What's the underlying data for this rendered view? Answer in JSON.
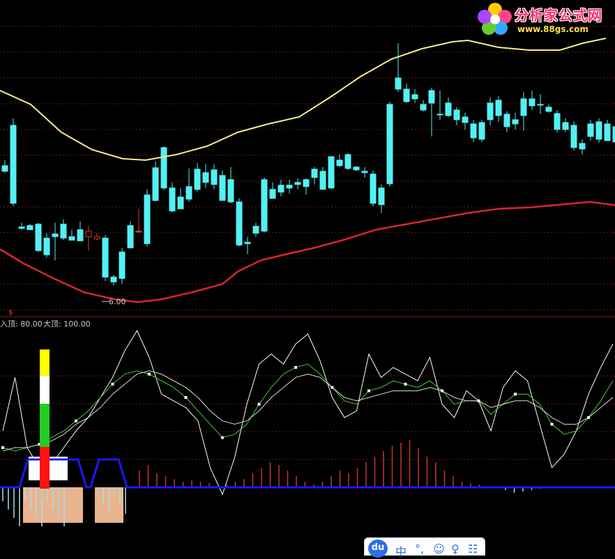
{
  "logo": {
    "site_name": "分析家公式网",
    "url": "www.88gs.com"
  },
  "upper_panel": {
    "low_marker": "6.00",
    "marker_symbol": "$"
  },
  "lower_panel": {
    "info_text_1": "入顶: 80.00",
    "info_text_2": "大顶: 100.00"
  },
  "ime_toolbar": {
    "badge": "du",
    "items": [
      "中",
      "°,",
      "☺",
      "♀",
      "☷"
    ]
  },
  "colors": {
    "background": "#000000",
    "up_candle": "#d9403a",
    "down_candle": "#54f0f2",
    "upper_band": "#f2f08a",
    "lower_band": "#d8272c",
    "osc_white": "#ffffff",
    "osc_green": "#44cc33",
    "baseline": "#1a1aff",
    "block_fill": "#e8b48e"
  },
  "chart_data": [
    {
      "type": "candlestick",
      "series_desc": "price panel",
      "x": [
        1,
        2,
        3,
        4,
        5,
        6,
        7,
        8,
        9,
        10,
        11,
        12,
        13,
        14,
        15,
        16,
        17,
        18,
        19,
        20,
        21,
        22,
        23,
        24,
        25,
        26,
        27,
        28,
        29,
        30,
        31,
        32,
        33,
        34,
        35,
        36,
        37,
        38,
        39,
        40,
        41,
        42,
        43,
        44,
        45,
        46,
        47,
        48,
        49,
        50,
        51,
        52,
        53,
        54,
        55,
        56,
        57,
        58,
        59,
        60,
        61,
        62,
        63,
        64,
        65,
        66,
        67,
        68,
        69,
        70,
        71,
        72,
        73
      ],
      "ohlc": [
        [
          238,
          230,
          248,
          246
        ],
        [
          180,
          170,
          296,
          292
        ],
        [
          326,
          320,
          330,
          328
        ],
        [
          324,
          322,
          330,
          330
        ],
        [
          322,
          320,
          362,
          360
        ],
        [
          342,
          335,
          370,
          366
        ],
        [
          336,
          320,
          374,
          340
        ],
        [
          322,
          315,
          345,
          342
        ],
        [
          340,
          330,
          345,
          345
        ],
        [
          330,
          318,
          346,
          346
        ],
        [
          340,
          325,
          360,
          332
        ],
        [
          343,
          335,
          345,
          340
        ],
        [
          342,
          338,
          404,
          398
        ],
        [
          398,
          395,
          410,
          405
        ],
        [
          362,
          356,
          408,
          400
        ],
        [
          324,
          318,
          357,
          356
        ],
        [
          333,
          300,
          335,
          332
        ],
        [
          280,
          272,
          354,
          350
        ],
        [
          241,
          232,
          289,
          288
        ],
        [
          212,
          210,
          273,
          270
        ],
        [
          270,
          262,
          305,
          303
        ],
        [
          283,
          270,
          300,
          300
        ],
        [
          268,
          242,
          290,
          286
        ],
        [
          243,
          234,
          275,
          272
        ],
        [
          248,
          236,
          270,
          262
        ],
        [
          244,
          236,
          272,
          265
        ],
        [
          252,
          245,
          288,
          288
        ],
        [
          258,
          240,
          292,
          290
        ],
        [
          290,
          285,
          354,
          352
        ],
        [
          348,
          340,
          365,
          350
        ],
        [
          325,
          320,
          340,
          335
        ],
        [
          258,
          255,
          334,
          332
        ],
        [
          272,
          262,
          285,
          285
        ],
        [
          266,
          258,
          282,
          276
        ],
        [
          266,
          258,
          278,
          270
        ],
        [
          262,
          256,
          272,
          265
        ],
        [
          258,
          256,
          280,
          268
        ],
        [
          243,
          240,
          265,
          255
        ],
        [
          246,
          240,
          272,
          272
        ],
        [
          225,
          225,
          272,
          270
        ],
        [
          230,
          222,
          240,
          238
        ],
        [
          222,
          220,
          244,
          242
        ],
        [
          240,
          238,
          246,
          244
        ],
        [
          246,
          240,
          255,
          248
        ],
        [
          250,
          245,
          296,
          292
        ],
        [
          270,
          265,
          306,
          294
        ],
        [
          150,
          146,
          268,
          264
        ],
        [
          112,
          62,
          132,
          128
        ],
        [
          128,
          120,
          148,
          146
        ],
        [
          136,
          128,
          148,
          142
        ],
        [
          150,
          144,
          160,
          158
        ],
        [
          130,
          126,
          196,
          148
        ],
        [
          164,
          130,
          172,
          164
        ],
        [
          148,
          140,
          168,
          166
        ],
        [
          158,
          154,
          180,
          172
        ],
        [
          168,
          162,
          186,
          176
        ],
        [
          178,
          172,
          204,
          198
        ],
        [
          176,
          172,
          204,
          200
        ],
        [
          148,
          140,
          180,
          172
        ],
        [
          144,
          138,
          175,
          166
        ],
        [
          164,
          160,
          190,
          182
        ],
        [
          172,
          162,
          186,
          178
        ],
        [
          142,
          132,
          188,
          166
        ],
        [
          142,
          130,
          158,
          152
        ],
        [
          150,
          135,
          164,
          150
        ],
        [
          154,
          150,
          162,
          160
        ],
        [
          163,
          158,
          190,
          186
        ],
        [
          176,
          170,
          190,
          186
        ],
        [
          180,
          174,
          216,
          212
        ],
        [
          206,
          200,
          222,
          214
        ],
        [
          178,
          172,
          202,
          196
        ],
        [
          175,
          170,
          205,
          200
        ],
        [
          178,
          172,
          202,
          202
        ],
        [
          182,
          176,
          206,
          204
        ],
        [
          186,
          180,
          212,
          206
        ],
        [
          176,
          168,
          204,
          200
        ],
        [
          172,
          165,
          200,
          198
        ],
        [
          166,
          160,
          178,
          170
        ],
        [
          150,
          145,
          172,
          166
        ],
        [
          64,
          52,
          122,
          118
        ]
      ],
      "upper_band": [
        [
          1,
          130
        ],
        [
          5,
          150
        ],
        [
          9,
          190
        ],
        [
          13,
          215
        ],
        [
          17,
          228
        ],
        [
          20,
          230
        ],
        [
          24,
          222
        ],
        [
          28,
          210
        ],
        [
          32,
          190
        ],
        [
          36,
          178
        ],
        [
          40,
          168
        ],
        [
          44,
          140
        ],
        [
          48,
          110
        ],
        [
          52,
          85
        ],
        [
          56,
          70
        ],
        [
          60,
          60
        ],
        [
          62,
          58
        ],
        [
          66,
          68
        ],
        [
          70,
          72
        ],
        [
          74,
          72
        ],
        [
          77,
          62
        ],
        [
          80,
          55
        ]
      ],
      "lower_band": [
        [
          1,
          358
        ],
        [
          4,
          378
        ],
        [
          8,
          400
        ],
        [
          12,
          420
        ],
        [
          16,
          430
        ],
        [
          19,
          434
        ],
        [
          22,
          430
        ],
        [
          26,
          420
        ],
        [
          30,
          408
        ],
        [
          32,
          390
        ],
        [
          35,
          374
        ],
        [
          38,
          366
        ],
        [
          42,
          356
        ],
        [
          46,
          344
        ],
        [
          50,
          330
        ],
        [
          54,
          322
        ],
        [
          58,
          314
        ],
        [
          62,
          306
        ],
        [
          66,
          300
        ],
        [
          70,
          298
        ],
        [
          74,
          294
        ],
        [
          78,
          290
        ],
        [
          82,
          296
        ]
      ]
    },
    {
      "type": "line",
      "series_desc": "oscillator panel",
      "ylim": [
        0,
        100
      ],
      "series": [
        {
          "values": [
            40,
            72,
            30,
            18,
            20,
            30,
            40,
            48,
            60,
            72,
            88,
            100,
            84,
            62,
            58,
            54,
            46,
            18,
            2,
            24,
            56,
            80,
            86,
            80,
            92,
            98,
            82,
            60,
            48,
            52,
            86,
            72,
            78,
            74,
            70,
            84,
            56,
            48,
            64,
            58,
            40,
            66,
            76,
            70,
            44,
            18,
            26,
            40,
            62,
            78,
            92
          ]
        },
        {
          "values": [
            30,
            28,
            30,
            32,
            36,
            40,
            46,
            52,
            60,
            68,
            74,
            76,
            74,
            70,
            66,
            60,
            52,
            44,
            36,
            38,
            44,
            56,
            66,
            74,
            78,
            80,
            74,
            66,
            58,
            56,
            64,
            66,
            70,
            68,
            66,
            70,
            64,
            56,
            58,
            58,
            50,
            56,
            62,
            62,
            56,
            44,
            38,
            40,
            48,
            58,
            70
          ]
        },
        {
          "values": [
            28,
            30,
            30,
            32,
            34,
            38,
            44,
            48,
            54,
            62,
            68,
            74,
            76,
            74,
            70,
            66,
            60,
            52,
            46,
            44,
            46,
            52,
            60,
            66,
            72,
            74,
            72,
            66,
            60,
            58,
            60,
            62,
            64,
            64,
            64,
            66,
            64,
            60,
            58,
            58,
            54,
            56,
            58,
            58,
            54,
            48,
            44,
            44,
            48,
            54,
            60
          ]
        }
      ],
      "histogram": [
        12,
        16,
        10,
        8,
        6,
        4,
        5,
        4,
        3,
        0,
        2,
        4,
        6,
        10,
        14,
        18,
        16,
        12,
        8,
        4,
        2,
        4,
        8,
        12,
        10,
        14,
        18,
        22,
        26,
        30,
        32,
        34,
        28,
        22,
        18,
        12,
        8,
        4,
        3,
        2,
        1,
        0,
        -2,
        -4,
        -3,
        -2,
        -1,
        0
      ],
      "thresholds": [
        {
          "label": "入顶",
          "value": 80
        },
        {
          "label": "大顶",
          "value": 100
        }
      ]
    }
  ]
}
